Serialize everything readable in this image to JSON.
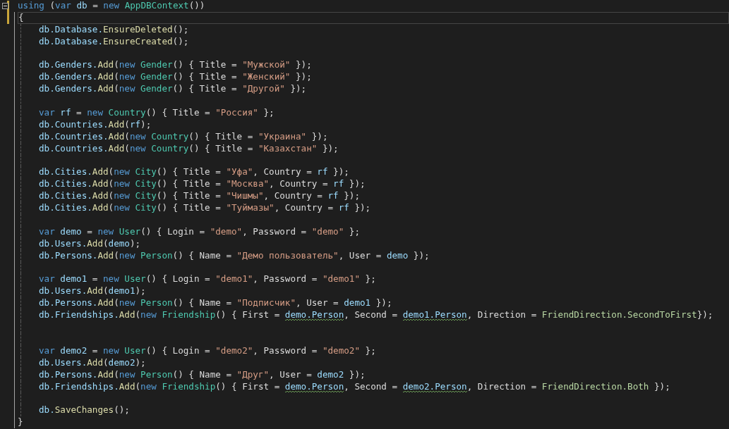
{
  "code_block": {
    "expanded": true,
    "changed": true,
    "header": [
      {
        "text": "using ",
        "kind": "keyword",
        "squiggle": false
      },
      {
        "text": "(",
        "kind": "plain",
        "squiggle": false
      },
      {
        "text": "var ",
        "kind": "keyword",
        "squiggle": false
      },
      {
        "text": "db",
        "kind": "variable",
        "squiggle": false
      },
      {
        "text": " = ",
        "kind": "plain",
        "squiggle": false
      },
      {
        "text": "new ",
        "kind": "keyword",
        "squiggle": false
      },
      {
        "text": "AppDBContext",
        "kind": "type",
        "squiggle": false
      },
      {
        "text": "())",
        "kind": "plain",
        "squiggle": false
      }
    ],
    "open_brace": {
      "text": "{",
      "current": true
    },
    "body": [
      {
        "kind": "code",
        "tokens": [
          {
            "text": "db.Database.",
            "kind": "variable",
            "squiggle": false
          },
          {
            "text": "EnsureDeleted",
            "kind": "method",
            "squiggle": false
          },
          {
            "text": "();",
            "kind": "plain",
            "squiggle": false
          }
        ]
      },
      {
        "kind": "code",
        "tokens": [
          {
            "text": "db.Database.",
            "kind": "variable",
            "squiggle": false
          },
          {
            "text": "EnsureCreated",
            "kind": "method",
            "squiggle": false
          },
          {
            "text": "();",
            "kind": "plain",
            "squiggle": false
          }
        ]
      },
      {
        "kind": "blank"
      },
      {
        "kind": "code",
        "tokens": [
          {
            "text": "db.Genders.",
            "kind": "variable",
            "squiggle": false
          },
          {
            "text": "Add",
            "kind": "method",
            "squiggle": false
          },
          {
            "text": "(",
            "kind": "plain",
            "squiggle": false
          },
          {
            "text": "new ",
            "kind": "keyword",
            "squiggle": false
          },
          {
            "text": "Gender",
            "kind": "type",
            "squiggle": false
          },
          {
            "text": "() { Title = ",
            "kind": "plain",
            "squiggle": false
          },
          {
            "text": "\"Мужской\"",
            "kind": "string",
            "squiggle": false
          },
          {
            "text": " });",
            "kind": "plain",
            "squiggle": false
          }
        ]
      },
      {
        "kind": "code",
        "tokens": [
          {
            "text": "db.Genders.",
            "kind": "variable",
            "squiggle": false
          },
          {
            "text": "Add",
            "kind": "method",
            "squiggle": false
          },
          {
            "text": "(",
            "kind": "plain",
            "squiggle": false
          },
          {
            "text": "new ",
            "kind": "keyword",
            "squiggle": false
          },
          {
            "text": "Gender",
            "kind": "type",
            "squiggle": false
          },
          {
            "text": "() { Title = ",
            "kind": "plain",
            "squiggle": false
          },
          {
            "text": "\"Женский\"",
            "kind": "string",
            "squiggle": false
          },
          {
            "text": " });",
            "kind": "plain",
            "squiggle": false
          }
        ]
      },
      {
        "kind": "code",
        "tokens": [
          {
            "text": "db.Genders.",
            "kind": "variable",
            "squiggle": false
          },
          {
            "text": "Add",
            "kind": "method",
            "squiggle": false
          },
          {
            "text": "(",
            "kind": "plain",
            "squiggle": false
          },
          {
            "text": "new ",
            "kind": "keyword",
            "squiggle": false
          },
          {
            "text": "Gender",
            "kind": "type",
            "squiggle": false
          },
          {
            "text": "() { Title = ",
            "kind": "plain",
            "squiggle": false
          },
          {
            "text": "\"Другой\"",
            "kind": "string",
            "squiggle": false
          },
          {
            "text": " });",
            "kind": "plain",
            "squiggle": false
          }
        ]
      },
      {
        "kind": "blank"
      },
      {
        "kind": "code",
        "tokens": [
          {
            "text": "var ",
            "kind": "keyword",
            "squiggle": false
          },
          {
            "text": "rf",
            "kind": "variable",
            "squiggle": false
          },
          {
            "text": " = ",
            "kind": "plain",
            "squiggle": false
          },
          {
            "text": "new ",
            "kind": "keyword",
            "squiggle": false
          },
          {
            "text": "Country",
            "kind": "type",
            "squiggle": false
          },
          {
            "text": "() { Title = ",
            "kind": "plain",
            "squiggle": false
          },
          {
            "text": "\"Россия\"",
            "kind": "string",
            "squiggle": false
          },
          {
            "text": " };",
            "kind": "plain",
            "squiggle": false
          }
        ]
      },
      {
        "kind": "code",
        "tokens": [
          {
            "text": "db.Countries.",
            "kind": "variable",
            "squiggle": false
          },
          {
            "text": "Add",
            "kind": "method",
            "squiggle": false
          },
          {
            "text": "(",
            "kind": "plain",
            "squiggle": false
          },
          {
            "text": "rf",
            "kind": "variable",
            "squiggle": false
          },
          {
            "text": ");",
            "kind": "plain",
            "squiggle": false
          }
        ]
      },
      {
        "kind": "code",
        "tokens": [
          {
            "text": "db.Countries.",
            "kind": "variable",
            "squiggle": false
          },
          {
            "text": "Add",
            "kind": "method",
            "squiggle": false
          },
          {
            "text": "(",
            "kind": "plain",
            "squiggle": false
          },
          {
            "text": "new ",
            "kind": "keyword",
            "squiggle": false
          },
          {
            "text": "Country",
            "kind": "type",
            "squiggle": false
          },
          {
            "text": "() { Title = ",
            "kind": "plain",
            "squiggle": false
          },
          {
            "text": "\"Украина\"",
            "kind": "string",
            "squiggle": false
          },
          {
            "text": " });",
            "kind": "plain",
            "squiggle": false
          }
        ]
      },
      {
        "kind": "code",
        "tokens": [
          {
            "text": "db.Countries.",
            "kind": "variable",
            "squiggle": false
          },
          {
            "text": "Add",
            "kind": "method",
            "squiggle": false
          },
          {
            "text": "(",
            "kind": "plain",
            "squiggle": false
          },
          {
            "text": "new ",
            "kind": "keyword",
            "squiggle": false
          },
          {
            "text": "Country",
            "kind": "type",
            "squiggle": false
          },
          {
            "text": "() { Title = ",
            "kind": "plain",
            "squiggle": false
          },
          {
            "text": "\"Казахстан\"",
            "kind": "string",
            "squiggle": false
          },
          {
            "text": " });",
            "kind": "plain",
            "squiggle": false
          }
        ]
      },
      {
        "kind": "blank"
      },
      {
        "kind": "code",
        "tokens": [
          {
            "text": "db.Cities.",
            "kind": "variable",
            "squiggle": false
          },
          {
            "text": "Add",
            "kind": "method",
            "squiggle": false
          },
          {
            "text": "(",
            "kind": "plain",
            "squiggle": false
          },
          {
            "text": "new ",
            "kind": "keyword",
            "squiggle": false
          },
          {
            "text": "City",
            "kind": "type",
            "squiggle": false
          },
          {
            "text": "() { Title = ",
            "kind": "plain",
            "squiggle": false
          },
          {
            "text": "\"Уфа\"",
            "kind": "string",
            "squiggle": false
          },
          {
            "text": ", Country = ",
            "kind": "plain",
            "squiggle": false
          },
          {
            "text": "rf",
            "kind": "variable",
            "squiggle": false
          },
          {
            "text": " });",
            "kind": "plain",
            "squiggle": false
          }
        ]
      },
      {
        "kind": "code",
        "tokens": [
          {
            "text": "db.Cities.",
            "kind": "variable",
            "squiggle": false
          },
          {
            "text": "Add",
            "kind": "method",
            "squiggle": false
          },
          {
            "text": "(",
            "kind": "plain",
            "squiggle": false
          },
          {
            "text": "new ",
            "kind": "keyword",
            "squiggle": false
          },
          {
            "text": "City",
            "kind": "type",
            "squiggle": false
          },
          {
            "text": "() { Title = ",
            "kind": "plain",
            "squiggle": false
          },
          {
            "text": "\"Москва\"",
            "kind": "string",
            "squiggle": false
          },
          {
            "text": ", Country = ",
            "kind": "plain",
            "squiggle": false
          },
          {
            "text": "rf",
            "kind": "variable",
            "squiggle": false
          },
          {
            "text": " });",
            "kind": "plain",
            "squiggle": false
          }
        ]
      },
      {
        "kind": "code",
        "tokens": [
          {
            "text": "db.Cities.",
            "kind": "variable",
            "squiggle": false
          },
          {
            "text": "Add",
            "kind": "method",
            "squiggle": false
          },
          {
            "text": "(",
            "kind": "plain",
            "squiggle": false
          },
          {
            "text": "new ",
            "kind": "keyword",
            "squiggle": false
          },
          {
            "text": "City",
            "kind": "type",
            "squiggle": false
          },
          {
            "text": "() { Title = ",
            "kind": "plain",
            "squiggle": false
          },
          {
            "text": "\"Чишмы\"",
            "kind": "string",
            "squiggle": false
          },
          {
            "text": ", Country = ",
            "kind": "plain",
            "squiggle": false
          },
          {
            "text": "rf",
            "kind": "variable",
            "squiggle": false
          },
          {
            "text": " });",
            "kind": "plain",
            "squiggle": false
          }
        ]
      },
      {
        "kind": "code",
        "tokens": [
          {
            "text": "db.Cities.",
            "kind": "variable",
            "squiggle": false
          },
          {
            "text": "Add",
            "kind": "method",
            "squiggle": false
          },
          {
            "text": "(",
            "kind": "plain",
            "squiggle": false
          },
          {
            "text": "new ",
            "kind": "keyword",
            "squiggle": false
          },
          {
            "text": "City",
            "kind": "type",
            "squiggle": false
          },
          {
            "text": "() { Title = ",
            "kind": "plain",
            "squiggle": false
          },
          {
            "text": "\"Туймазы\"",
            "kind": "string",
            "squiggle": false
          },
          {
            "text": ", Country = ",
            "kind": "plain",
            "squiggle": false
          },
          {
            "text": "rf",
            "kind": "variable",
            "squiggle": false
          },
          {
            "text": " });",
            "kind": "plain",
            "squiggle": false
          }
        ]
      },
      {
        "kind": "blank"
      },
      {
        "kind": "code",
        "tokens": [
          {
            "text": "var ",
            "kind": "keyword",
            "squiggle": false
          },
          {
            "text": "demo",
            "kind": "variable",
            "squiggle": false
          },
          {
            "text": " = ",
            "kind": "plain",
            "squiggle": false
          },
          {
            "text": "new ",
            "kind": "keyword",
            "squiggle": false
          },
          {
            "text": "User",
            "kind": "type",
            "squiggle": false
          },
          {
            "text": "() { Login = ",
            "kind": "plain",
            "squiggle": false
          },
          {
            "text": "\"demo\"",
            "kind": "string",
            "squiggle": false
          },
          {
            "text": ", Password = ",
            "kind": "plain",
            "squiggle": false
          },
          {
            "text": "\"demo\"",
            "kind": "string",
            "squiggle": false
          },
          {
            "text": " };",
            "kind": "plain",
            "squiggle": false
          }
        ]
      },
      {
        "kind": "code",
        "tokens": [
          {
            "text": "db.Users.",
            "kind": "variable",
            "squiggle": false
          },
          {
            "text": "Add",
            "kind": "method",
            "squiggle": false
          },
          {
            "text": "(",
            "kind": "plain",
            "squiggle": false
          },
          {
            "text": "demo",
            "kind": "variable",
            "squiggle": false
          },
          {
            "text": ");",
            "kind": "plain",
            "squiggle": false
          }
        ]
      },
      {
        "kind": "code",
        "tokens": [
          {
            "text": "db.Persons.",
            "kind": "variable",
            "squiggle": false
          },
          {
            "text": "Add",
            "kind": "method",
            "squiggle": false
          },
          {
            "text": "(",
            "kind": "plain",
            "squiggle": false
          },
          {
            "text": "new ",
            "kind": "keyword",
            "squiggle": false
          },
          {
            "text": "Person",
            "kind": "type",
            "squiggle": false
          },
          {
            "text": "() { Name = ",
            "kind": "plain",
            "squiggle": false
          },
          {
            "text": "\"Демо пользователь\"",
            "kind": "string",
            "squiggle": false
          },
          {
            "text": ", User = ",
            "kind": "plain",
            "squiggle": false
          },
          {
            "text": "demo",
            "kind": "variable",
            "squiggle": false
          },
          {
            "text": " });",
            "kind": "plain",
            "squiggle": false
          }
        ]
      },
      {
        "kind": "blank"
      },
      {
        "kind": "code",
        "tokens": [
          {
            "text": "var ",
            "kind": "keyword",
            "squiggle": false
          },
          {
            "text": "demo1",
            "kind": "variable",
            "squiggle": false
          },
          {
            "text": " = ",
            "kind": "plain",
            "squiggle": false
          },
          {
            "text": "new ",
            "kind": "keyword",
            "squiggle": false
          },
          {
            "text": "User",
            "kind": "type",
            "squiggle": false
          },
          {
            "text": "() { Login = ",
            "kind": "plain",
            "squiggle": false
          },
          {
            "text": "\"demo1\"",
            "kind": "string",
            "squiggle": false
          },
          {
            "text": ", Password = ",
            "kind": "plain",
            "squiggle": false
          },
          {
            "text": "\"demo1\"",
            "kind": "string",
            "squiggle": false
          },
          {
            "text": " };",
            "kind": "plain",
            "squiggle": false
          }
        ]
      },
      {
        "kind": "code",
        "tokens": [
          {
            "text": "db.Users.",
            "kind": "variable",
            "squiggle": false
          },
          {
            "text": "Add",
            "kind": "method",
            "squiggle": false
          },
          {
            "text": "(",
            "kind": "plain",
            "squiggle": false
          },
          {
            "text": "demo1",
            "kind": "variable",
            "squiggle": false
          },
          {
            "text": ");",
            "kind": "plain",
            "squiggle": false
          }
        ]
      },
      {
        "kind": "code",
        "tokens": [
          {
            "text": "db.Persons.",
            "kind": "variable",
            "squiggle": false
          },
          {
            "text": "Add",
            "kind": "method",
            "squiggle": false
          },
          {
            "text": "(",
            "kind": "plain",
            "squiggle": false
          },
          {
            "text": "new ",
            "kind": "keyword",
            "squiggle": false
          },
          {
            "text": "Person",
            "kind": "type",
            "squiggle": false
          },
          {
            "text": "() { Name = ",
            "kind": "plain",
            "squiggle": false
          },
          {
            "text": "\"Подписчик\"",
            "kind": "string",
            "squiggle": false
          },
          {
            "text": ", User = ",
            "kind": "plain",
            "squiggle": false
          },
          {
            "text": "demo1",
            "kind": "variable",
            "squiggle": false
          },
          {
            "text": " });",
            "kind": "plain",
            "squiggle": false
          }
        ]
      },
      {
        "kind": "code",
        "tokens": [
          {
            "text": "db.Friendships.",
            "kind": "variable",
            "squiggle": false
          },
          {
            "text": "Add",
            "kind": "method",
            "squiggle": false
          },
          {
            "text": "(",
            "kind": "plain",
            "squiggle": false
          },
          {
            "text": "new ",
            "kind": "keyword",
            "squiggle": false
          },
          {
            "text": "Friendship",
            "kind": "type",
            "squiggle": false
          },
          {
            "text": "() { First = ",
            "kind": "plain",
            "squiggle": false
          },
          {
            "text": "demo.Person",
            "kind": "variable",
            "squiggle": true
          },
          {
            "text": ", Second = ",
            "kind": "plain",
            "squiggle": false
          },
          {
            "text": "demo1.Person",
            "kind": "variable",
            "squiggle": true
          },
          {
            "text": ", Direction = ",
            "kind": "plain",
            "squiggle": false
          },
          {
            "text": "FriendDirection.SecondToFirst",
            "kind": "enum",
            "squiggle": false
          },
          {
            "text": "});",
            "kind": "plain",
            "squiggle": false
          }
        ]
      },
      {
        "kind": "blank"
      },
      {
        "kind": "blank"
      },
      {
        "kind": "code",
        "tokens": [
          {
            "text": "var ",
            "kind": "keyword",
            "squiggle": false
          },
          {
            "text": "demo2",
            "kind": "variable",
            "squiggle": false
          },
          {
            "text": " = ",
            "kind": "plain",
            "squiggle": false
          },
          {
            "text": "new ",
            "kind": "keyword",
            "squiggle": false
          },
          {
            "text": "User",
            "kind": "type",
            "squiggle": false
          },
          {
            "text": "() { Login = ",
            "kind": "plain",
            "squiggle": false
          },
          {
            "text": "\"demo2\"",
            "kind": "string",
            "squiggle": false
          },
          {
            "text": ", Password = ",
            "kind": "plain",
            "squiggle": false
          },
          {
            "text": "\"demo2\"",
            "kind": "string",
            "squiggle": false
          },
          {
            "text": " };",
            "kind": "plain",
            "squiggle": false
          }
        ]
      },
      {
        "kind": "code",
        "tokens": [
          {
            "text": "db.Users.",
            "kind": "variable",
            "squiggle": false
          },
          {
            "text": "Add",
            "kind": "method",
            "squiggle": false
          },
          {
            "text": "(",
            "kind": "plain",
            "squiggle": false
          },
          {
            "text": "demo2",
            "kind": "variable",
            "squiggle": false
          },
          {
            "text": ");",
            "kind": "plain",
            "squiggle": false
          }
        ]
      },
      {
        "kind": "code",
        "tokens": [
          {
            "text": "db.Persons.",
            "kind": "variable",
            "squiggle": false
          },
          {
            "text": "Add",
            "kind": "method",
            "squiggle": false
          },
          {
            "text": "(",
            "kind": "plain",
            "squiggle": false
          },
          {
            "text": "new ",
            "kind": "keyword",
            "squiggle": false
          },
          {
            "text": "Person",
            "kind": "type",
            "squiggle": false
          },
          {
            "text": "() { Name = ",
            "kind": "plain",
            "squiggle": false
          },
          {
            "text": "\"Друг\"",
            "kind": "string",
            "squiggle": false
          },
          {
            "text": ", User = ",
            "kind": "plain",
            "squiggle": false
          },
          {
            "text": "demo2",
            "kind": "variable",
            "squiggle": false
          },
          {
            "text": " });",
            "kind": "plain",
            "squiggle": false
          }
        ]
      },
      {
        "kind": "code",
        "tokens": [
          {
            "text": "db.Friendships.",
            "kind": "variable",
            "squiggle": false
          },
          {
            "text": "Add",
            "kind": "method",
            "squiggle": false
          },
          {
            "text": "(",
            "kind": "plain",
            "squiggle": false
          },
          {
            "text": "new ",
            "kind": "keyword",
            "squiggle": false
          },
          {
            "text": "Friendship",
            "kind": "type",
            "squiggle": false
          },
          {
            "text": "() { First = ",
            "kind": "plain",
            "squiggle": false
          },
          {
            "text": "demo.Person",
            "kind": "variable",
            "squiggle": true
          },
          {
            "text": ", Second = ",
            "kind": "plain",
            "squiggle": false
          },
          {
            "text": "demo2.Person",
            "kind": "variable",
            "squiggle": true
          },
          {
            "text": ", Direction = ",
            "kind": "plain",
            "squiggle": false
          },
          {
            "text": "FriendDirection.Both",
            "kind": "enum",
            "squiggle": false
          },
          {
            "text": " });",
            "kind": "plain",
            "squiggle": false
          }
        ]
      },
      {
        "kind": "blank"
      },
      {
        "kind": "code",
        "tokens": [
          {
            "text": "db.",
            "kind": "variable",
            "squiggle": false
          },
          {
            "text": "SaveChanges",
            "kind": "method",
            "squiggle": false
          },
          {
            "text": "();",
            "kind": "plain",
            "squiggle": false
          }
        ]
      }
    ],
    "close_brace": "}"
  }
}
